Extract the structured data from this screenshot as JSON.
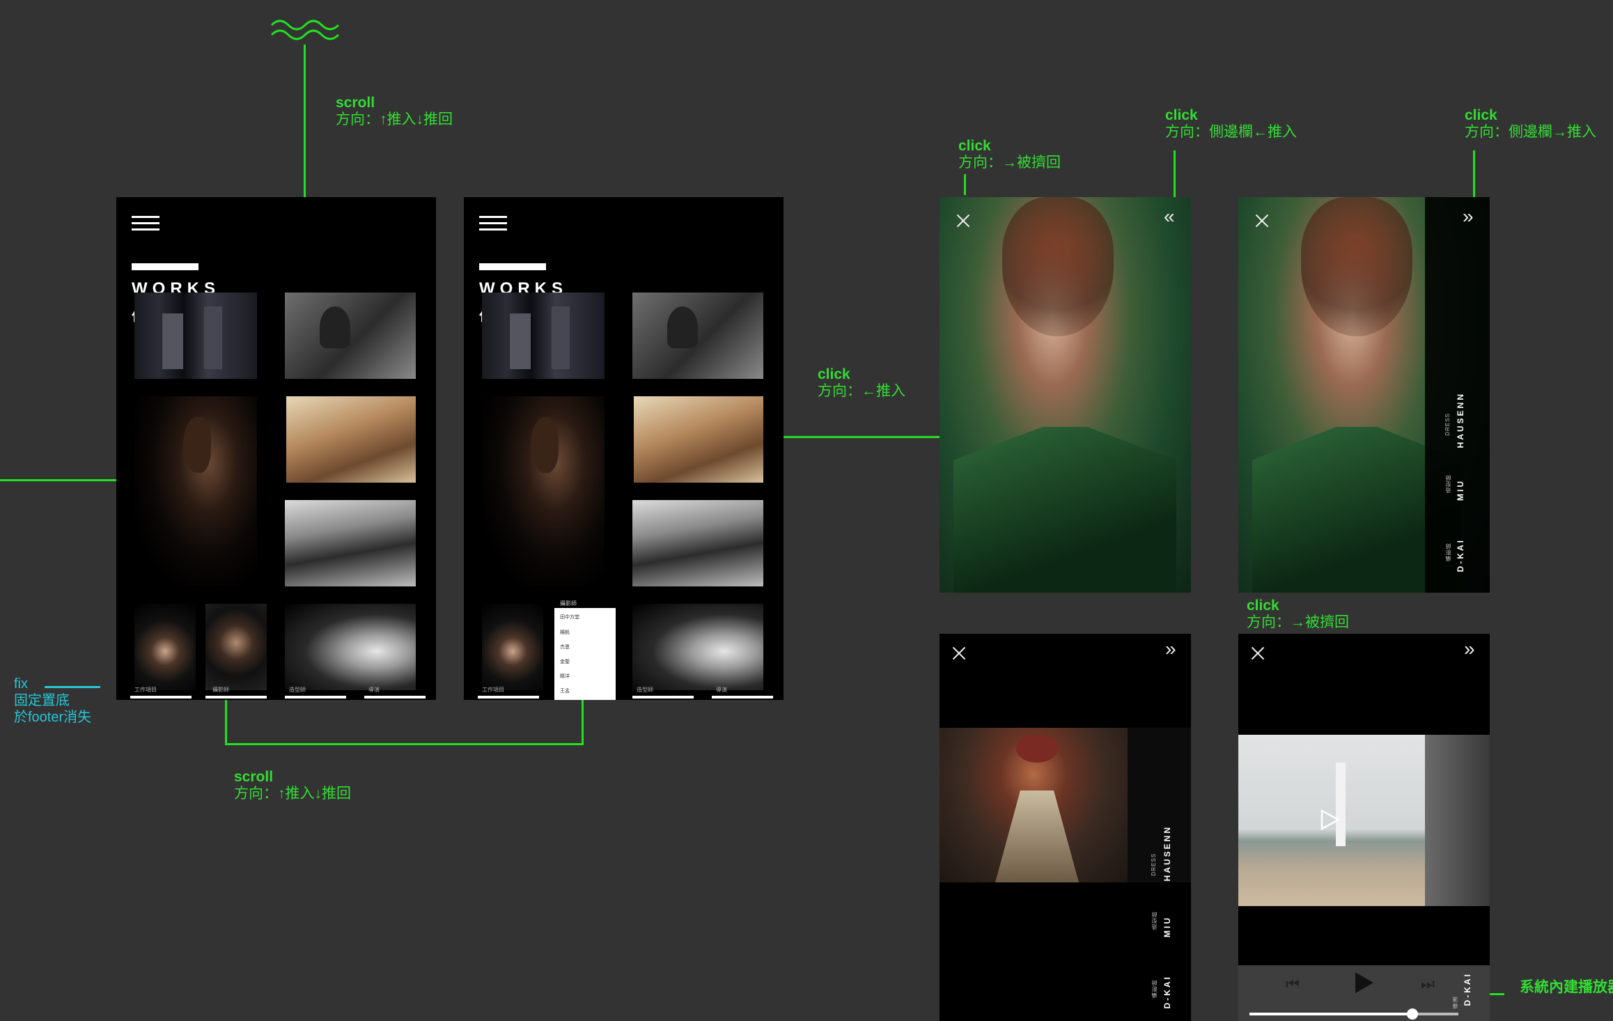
{
  "annotations": {
    "scroll_top": {
      "title": "scroll",
      "desc": "方向：↑推入↓推回"
    },
    "scroll_bottom": {
      "title": "scroll",
      "desc": "方向：↑推入↓推回"
    },
    "fix": {
      "title": "fix",
      "line1": "固定置底",
      "line2": "於footer消失"
    },
    "click_push": {
      "title": "click",
      "desc": "方向：←推入"
    },
    "click_close": {
      "title": "click",
      "desc": "方向：→被擠回"
    },
    "click_sidebar_in": {
      "title": "click",
      "desc": "方向：側邊欄←推入"
    },
    "click_sidebar_out": {
      "title": "click",
      "desc": "方向：側邊欄→推入"
    },
    "click_close_video": {
      "title": "click",
      "desc": "方向：→被擠回"
    },
    "player": {
      "label": "系統內建播放器"
    }
  },
  "works_page": {
    "title": "WORKS",
    "subtitle": "作品",
    "footer_labels": [
      "工作項目",
      "攝影師",
      "造型師",
      "導演"
    ]
  },
  "filter_dropdown": {
    "header": "攝影師",
    "options": [
      "田中方堂",
      "楊帆",
      "杰恩",
      "金聖",
      "精洋",
      "王孟"
    ]
  },
  "credits": [
    {
      "role": "DRESS",
      "name": "HAUSENN"
    },
    {
      "role": "造型師",
      "name": "MIU"
    },
    {
      "role": "攝影師",
      "name": "D-KAI"
    }
  ],
  "video_credits": [
    {
      "role": "導演",
      "name": "D-KAI"
    }
  ],
  "player_progress": 0.78,
  "colors": {
    "annotation": "#22e022",
    "fix_annotation": "#27c6d6",
    "background": "#333333"
  }
}
